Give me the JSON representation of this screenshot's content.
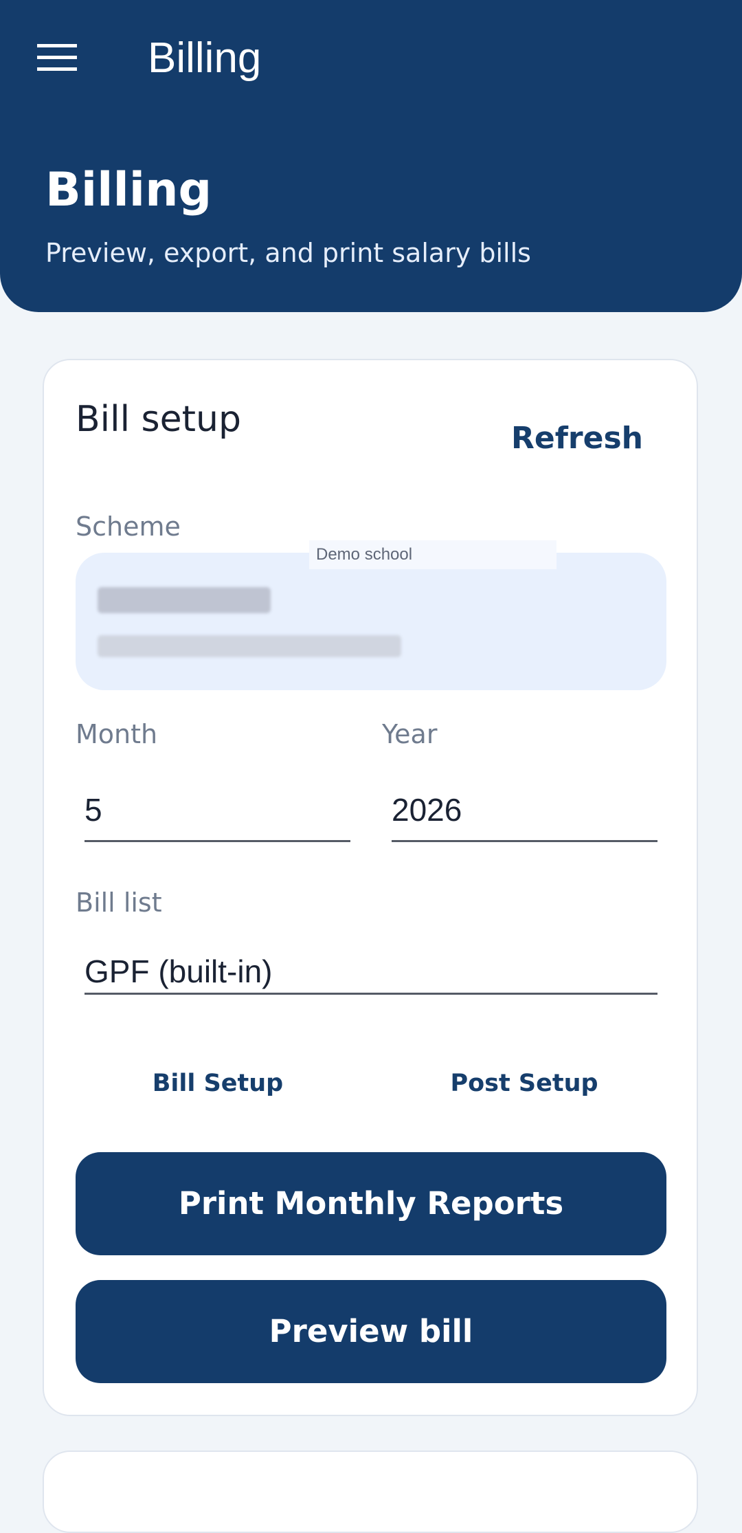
{
  "app_bar": {
    "title": "Billing",
    "menu_icon": "hamburger-menu-icon",
    "background": "#143c6b"
  },
  "hero": {
    "title": "Billing",
    "subtitle": "Preview, export, and print salary bills"
  },
  "bill_setup": {
    "title": "Bill setup",
    "refresh_label": "Refresh",
    "scheme": {
      "label": "Scheme",
      "tag": "Demo school"
    },
    "month": {
      "label": "Month",
      "value": "5"
    },
    "year": {
      "label": "Year",
      "value": "2026"
    },
    "bill_list": {
      "label": "Bill list",
      "value": "GPF (built-in)"
    },
    "links": {
      "bill_setup": "Bill Setup",
      "post_setup": "Post Setup"
    },
    "buttons": {
      "print_reports": "Print Monthly Reports",
      "preview_bill": "Preview bill"
    }
  },
  "colors": {
    "primary": "#143c6b",
    "background": "#f1f5f9",
    "scheme_box": "#e8f0fd"
  }
}
